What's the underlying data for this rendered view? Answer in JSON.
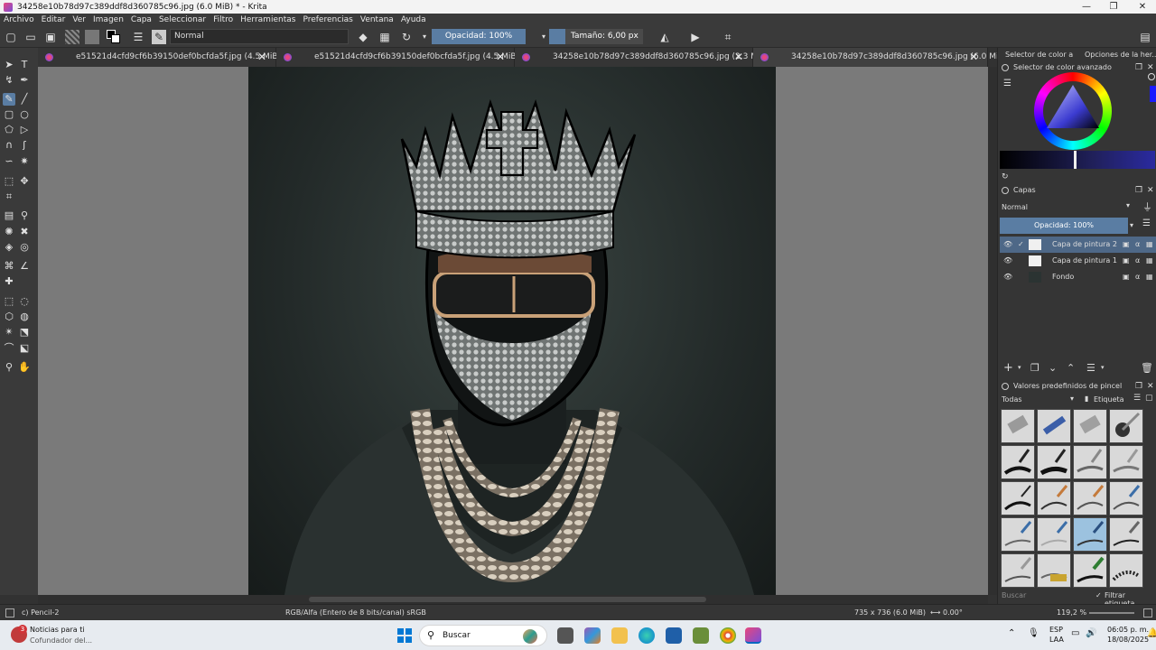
{
  "window": {
    "title": "34258e10b78d97c389ddf8d360785c96.jpg (6.0 MiB) * - Krita",
    "minimize": "—",
    "maximize": "❐",
    "close": "✕"
  },
  "menu": [
    "Archivo",
    "Editar",
    "Ver",
    "Imagen",
    "Capa",
    "Seleccionar",
    "Filtro",
    "Herramientas",
    "Preferencias",
    "Ventana",
    "Ayuda"
  ],
  "toolbar": {
    "blend_mode": "Normal",
    "opacity": "Opacidad: 100%",
    "size": "Tamaño: 6,00 px"
  },
  "tabs": [
    {
      "label": "e51521d4cfd9cf6b39150def0bcfda5f.jpg (4.5 MiB) *"
    },
    {
      "label": "e51521d4cfd9cf6b39150def0bcfda5f.jpg (4.5 MiB)"
    },
    {
      "label": "34258e10b78d97c389ddf8d360785c96.jpg (2.3 MiB) *"
    },
    {
      "label": "34258e10b78d97c389ddf8d360785c96.jpg (6.0 MiB) *"
    }
  ],
  "docker": {
    "tab1": "Selector de color a...",
    "tab2": "Opciones de la her...",
    "color_selector_title": "Selector de color avanzado",
    "layers_title": "Capas",
    "layers_blend": "Normal",
    "layers_opacity": "Opacidad: 100%",
    "layers": [
      {
        "name": "Capa de pintura 2",
        "selected": true
      },
      {
        "name": "Capa de pintura 1",
        "selected": false
      },
      {
        "name": "Fondo",
        "selected": false
      }
    ],
    "brush_title": "Valores predefinidos de pincel",
    "brush_filter": "Todas",
    "brush_tag": "Etiqueta",
    "search_placeholder": "Buscar",
    "filter_tag": "Filtrar etiqueta"
  },
  "status": {
    "brush": "c) Pencil-2",
    "color_model": "RGB/Alfa (Entero de 8 bits/canal)  sRGB",
    "dimensions": "735 x 736 (6.0 MiB)",
    "rotation": "0.00°",
    "zoom": "119,2 %"
  },
  "taskbar": {
    "news_title": "Noticias para ti",
    "news_sub": "Cofundador del...",
    "news_badge": "3",
    "search": "Buscar",
    "lang1": "ESP",
    "lang2": "LAA",
    "time": "06:05 p. m.",
    "date": "18/08/2025"
  },
  "colors": {
    "accent": "#5a7da3",
    "layer_selected": "#4e6887",
    "panel": "#353535"
  }
}
